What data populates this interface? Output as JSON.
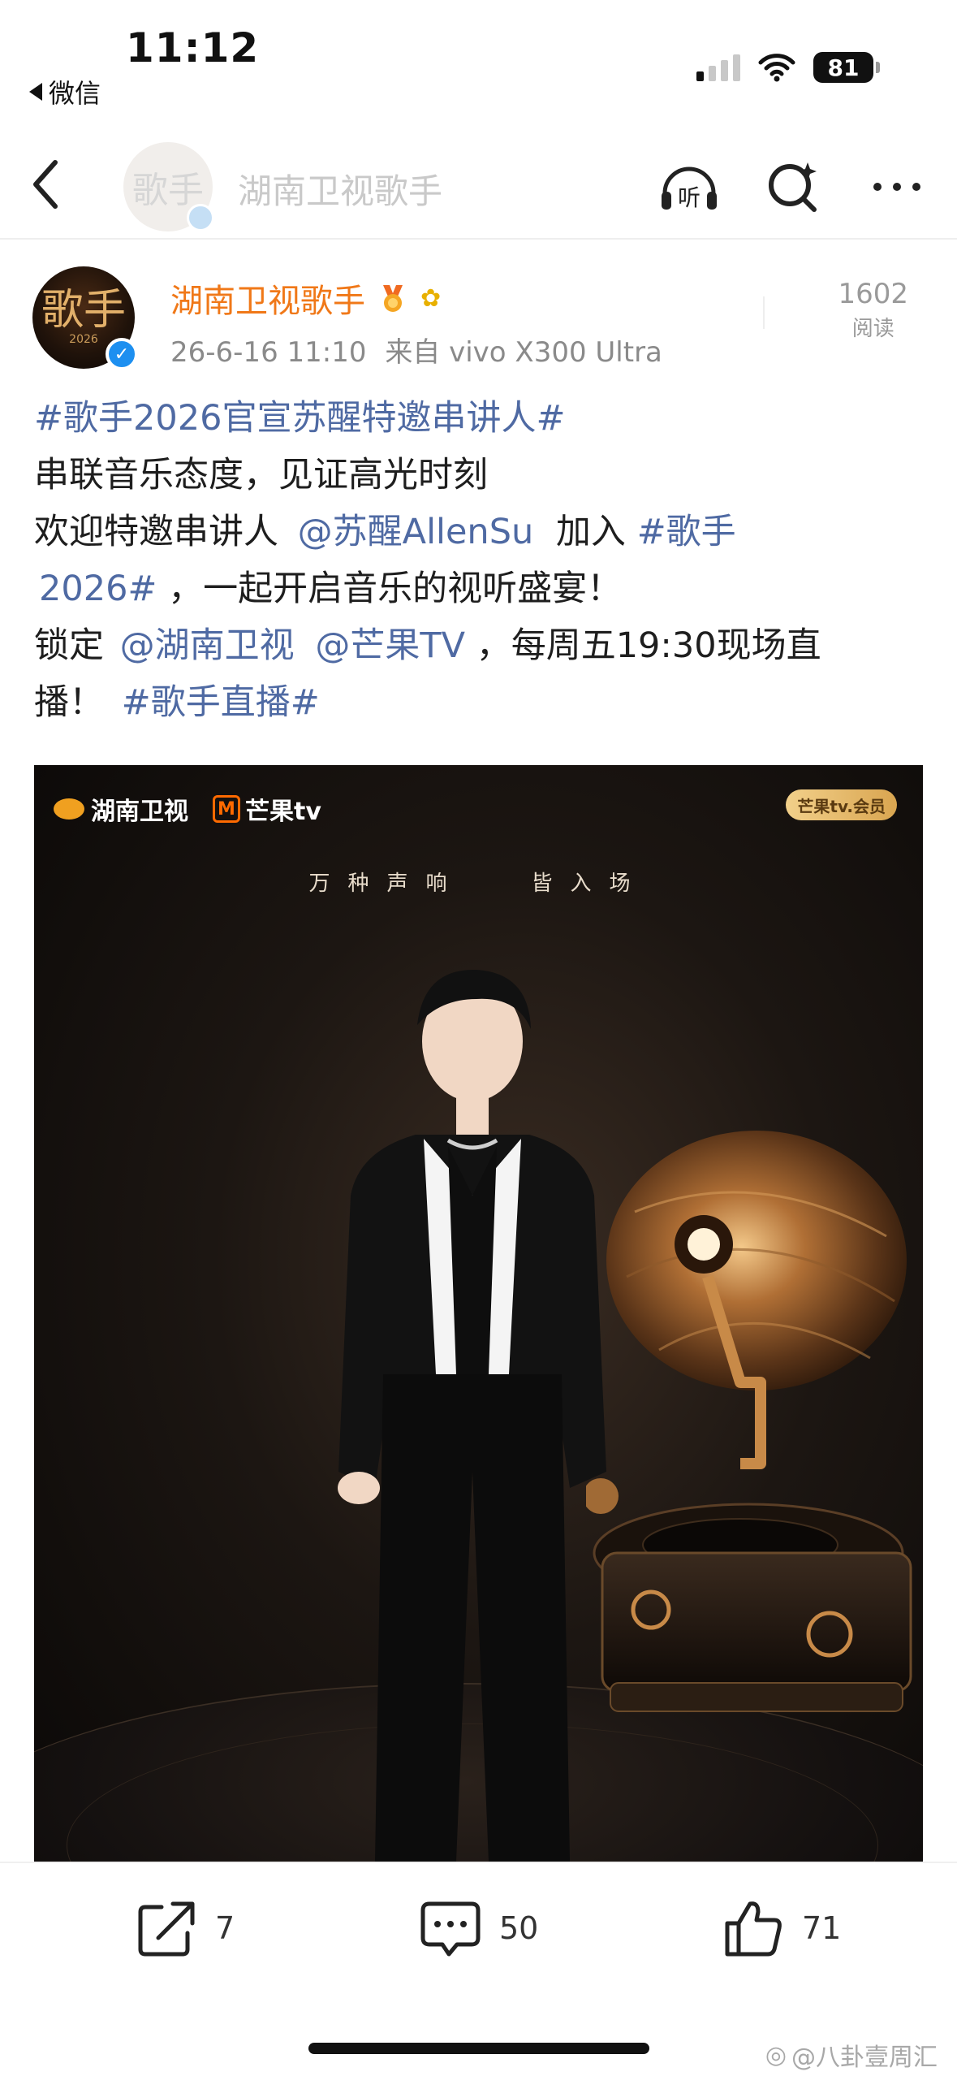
{
  "status_bar": {
    "time": "11:12",
    "back_app": "微信",
    "battery": "81"
  },
  "nav": {
    "title": "湖南卫视歌手",
    "avatar_text": "歌手",
    "icons": [
      "back-icon",
      "listen-icon",
      "search-icon",
      "more-icon"
    ],
    "listen_label": "听"
  },
  "post": {
    "author": "湖南卫视歌手",
    "avatar_text": "歌手",
    "avatar_year": "2026",
    "date": "26-6-16 11:10",
    "source": "来自 vivo X300 Ultra",
    "read_count": "1602",
    "read_label": "阅读",
    "accent_color": "#f07818",
    "link_color": "#4f6aa3",
    "lines": {
      "l1_tag": "#歌手2026官宣苏醒特邀串讲人#",
      "l2": "串联音乐态度，见证高光时刻",
      "l3_prefix": "欢迎特邀串讲人",
      "l3_mention": "@苏醒AllenSu",
      "l3_mid": "加入",
      "l3_tag_a": "#歌手",
      "l4_tag_b": "2026#",
      "l4_rest": "，一起开启音乐的视听盛宴！",
      "l5_prefix": "锁定",
      "l5_mention_a": "@湖南卫视",
      "l5_mention_b": "@芒果TV",
      "l5_rest": "，每周五19:30现场直",
      "l6_prefix": "播！",
      "l6_tag": "#歌手直播#"
    }
  },
  "poster": {
    "logo_hunan": "湖南卫视",
    "logo_mango": "芒果tv",
    "mango_mark": "M",
    "member_badge": "芒果tv.会员",
    "slogan_left": "万种声响",
    "slogan_right": "皆入场"
  },
  "actions": {
    "share_count": "7",
    "comment_count": "50",
    "like_count": "71"
  },
  "watermark": "@八卦壹周汇"
}
